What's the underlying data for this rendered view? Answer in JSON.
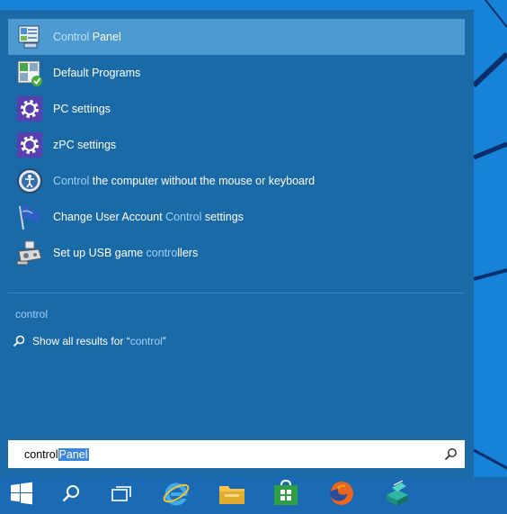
{
  "start_menu": {
    "results": [
      {
        "pre": "",
        "hl": "Control",
        "post": " Panel",
        "icon": "control-panel-icon",
        "selected": true
      },
      {
        "pre": "Default Programs",
        "hl": "",
        "post": "",
        "icon": "default-programs-icon"
      },
      {
        "pre": "PC settings",
        "hl": "",
        "post": "",
        "icon": "gear-icon"
      },
      {
        "pre": "zPC settings",
        "hl": "",
        "post": "",
        "icon": "gear-icon"
      },
      {
        "pre": "",
        "hl": "Control",
        "post": " the computer without the mouse or keyboard",
        "icon": "ease-of-access-icon"
      },
      {
        "pre": "Change User Account ",
        "hl": "Control",
        "post": " settings",
        "icon": "uac-flag-icon"
      },
      {
        "pre": "Set up USB game ",
        "hl": "contro",
        "post": "llers",
        "icon": "game-controller-icon"
      }
    ],
    "section_label": "control",
    "show_all": {
      "prefix": "Show all results for “",
      "query": "control",
      "suffix": "”"
    },
    "search": {
      "typed": "control",
      "selected": "Panel"
    }
  },
  "taskbar": {
    "items": [
      "start-button",
      "search-button",
      "task-view-button",
      "internet-explorer",
      "file-explorer",
      "store",
      "firefox",
      "app"
    ]
  },
  "colors": {
    "menu_bg": "#1a6aa8",
    "selected_bg": "#4c9ad0",
    "highlight_text": "#9fd1f5",
    "taskbar_bg": "#1b6bb4",
    "desktop_bg": "#1683d8"
  }
}
